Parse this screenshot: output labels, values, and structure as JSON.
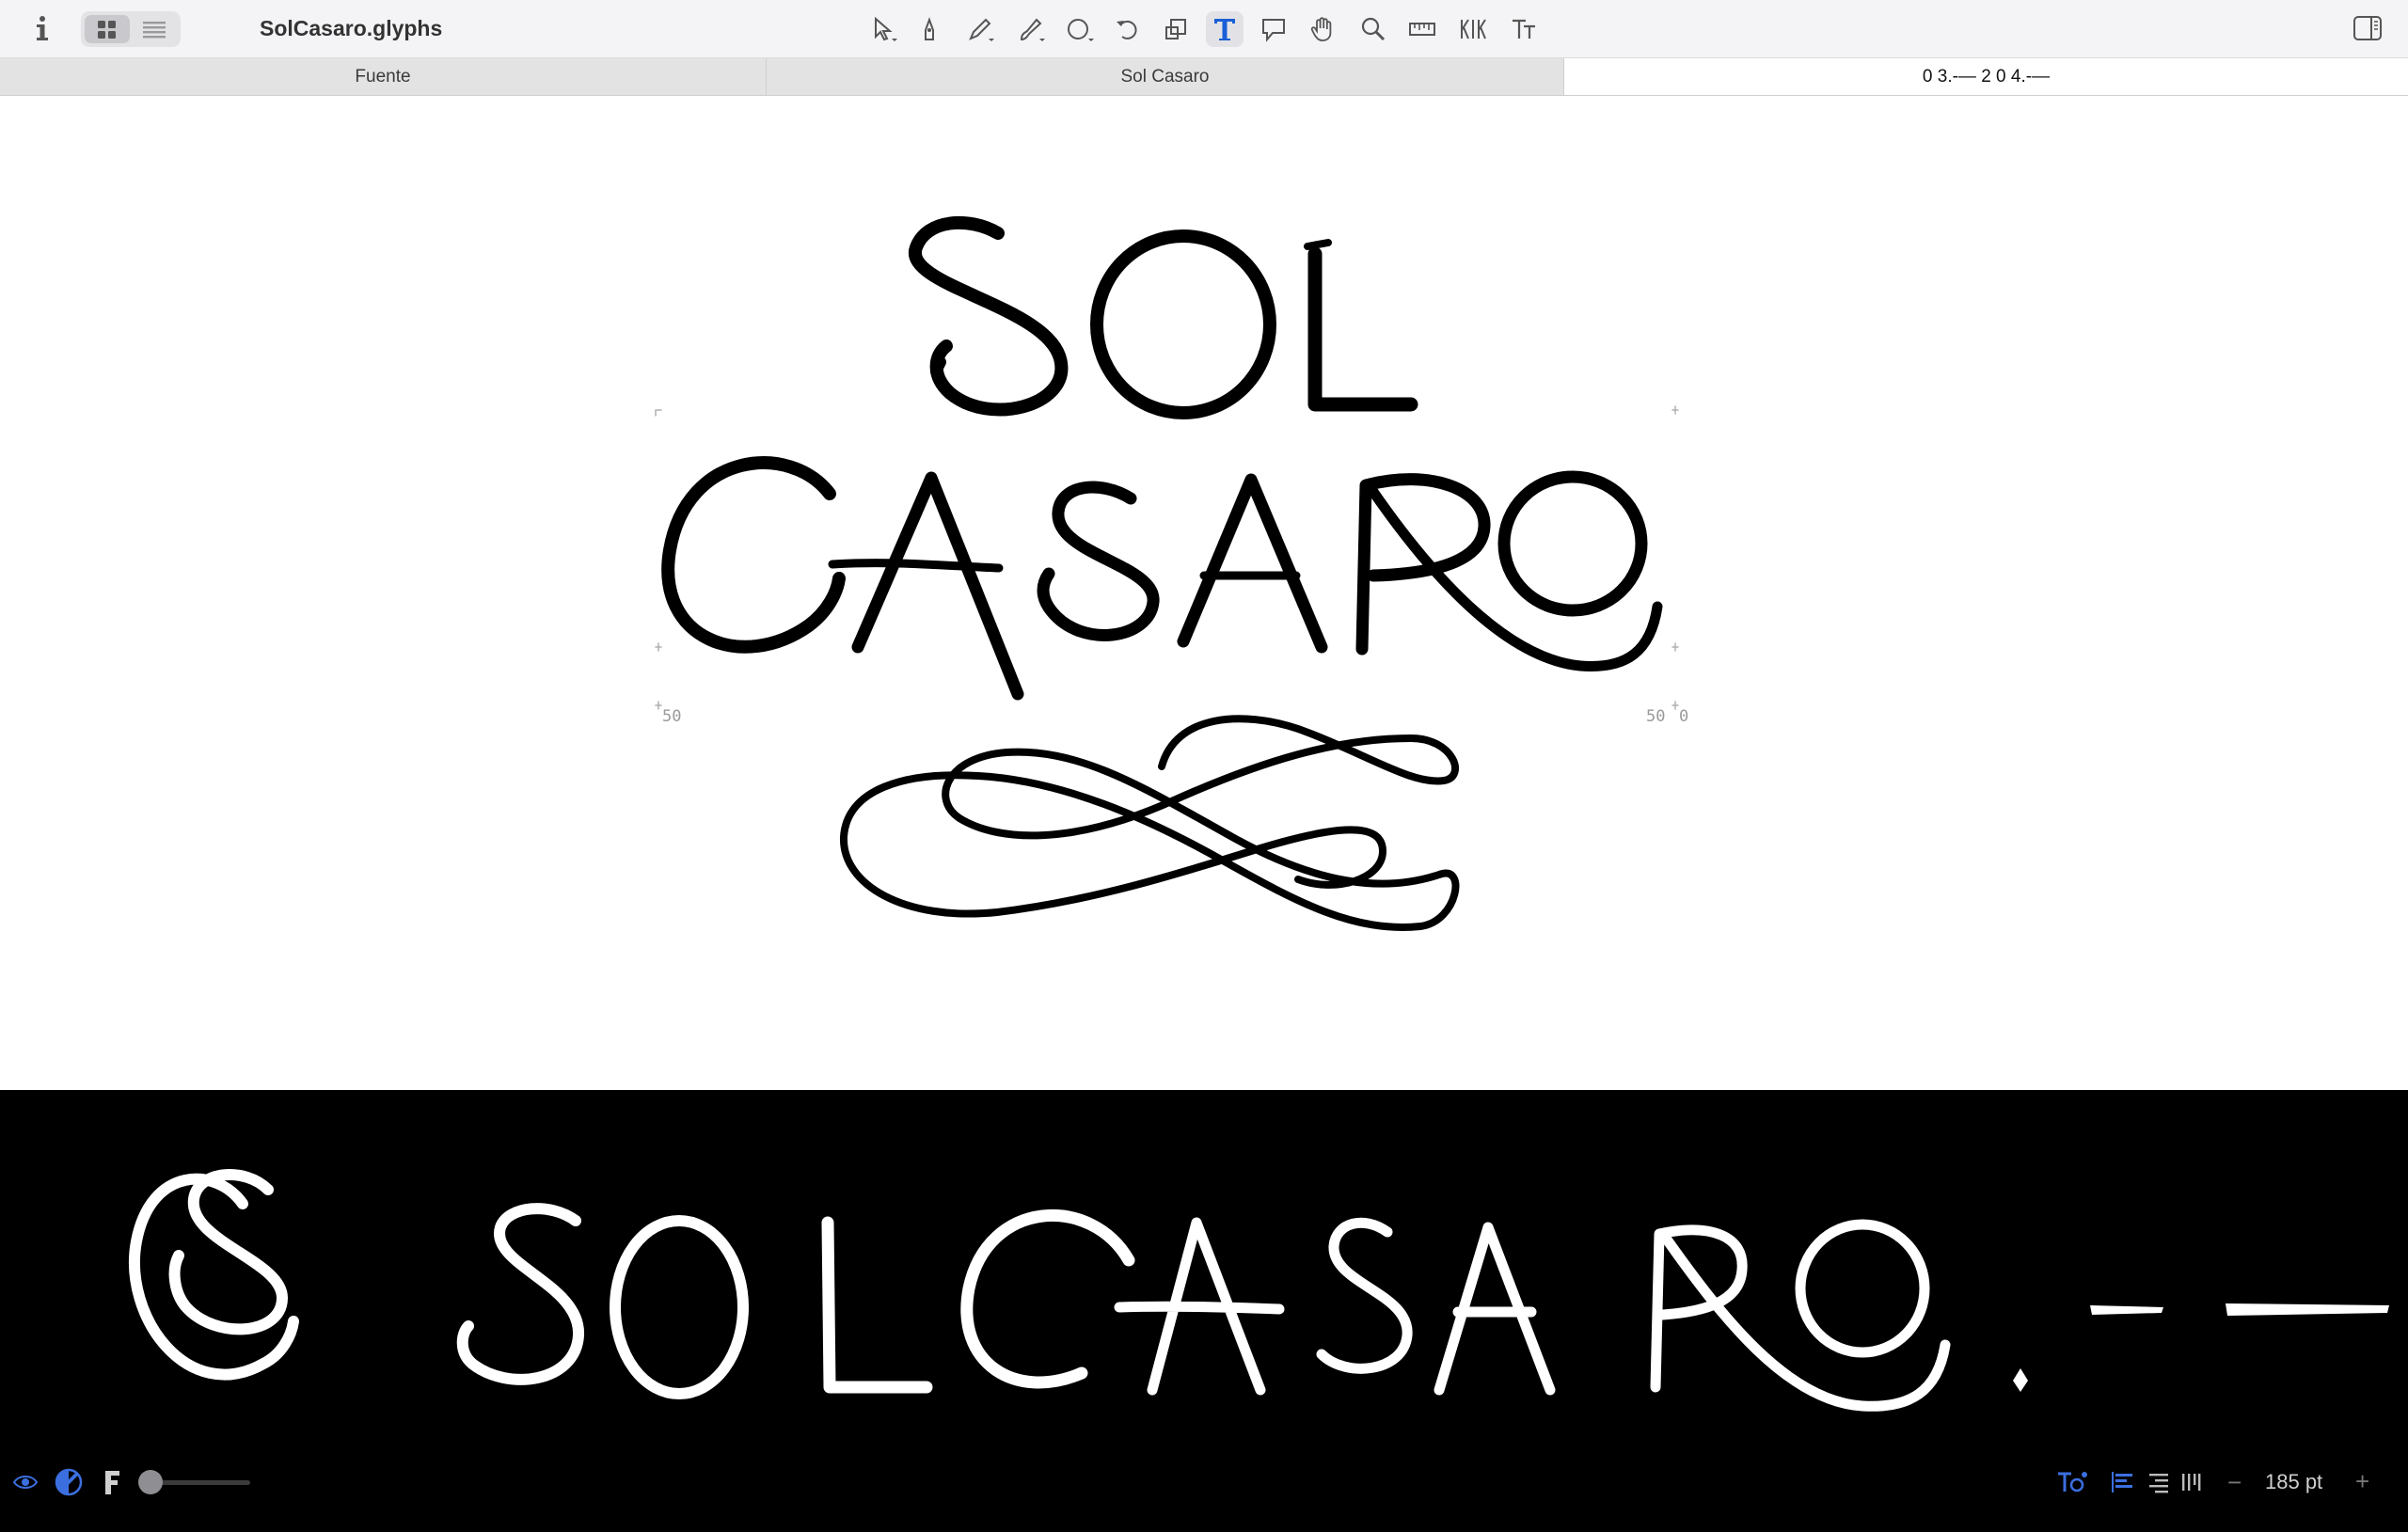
{
  "window": {
    "title": "SolCasaro.glyphs",
    "accent_color": "#1a5fd6"
  },
  "toolbar": {
    "info_icon": "info-icon",
    "view_modes": [
      "grid-view-icon",
      "list-view-icon"
    ],
    "active_view": "grid-view-icon",
    "tools": [
      "select-tool-icon",
      "draw-tool-icon",
      "pencil-tool-icon",
      "brush-tool-icon",
      "primitives-tool-icon",
      "rotate-tool-icon",
      "scale-tool-icon",
      "text-tool-icon",
      "annotation-tool-icon",
      "hand-tool-icon",
      "zoom-tool-icon",
      "measurement-tool-icon",
      "kerning-tool-icon",
      "text-metrics-tool-icon"
    ],
    "active_tool": "text-tool-icon",
    "right_icon": "sidebar-toggle-icon"
  },
  "tabs": [
    {
      "label": "Fuente"
    },
    {
      "label": "Sol Casaro"
    },
    {
      "label": "0 3.-— 2  0 4.-—"
    }
  ],
  "canvas": {
    "line_1": "SOL",
    "line_2": "CASARO",
    "ornament": "flourish",
    "metrics": {
      "left_sidebearing": "50",
      "right_sidebearing": "50",
      "right_extra": "0"
    }
  },
  "preview": {
    "text": "ꟷ SOLCASARO.-—",
    "glyphs": [
      "S-over-C-monogram",
      "S",
      "O",
      "L",
      "C",
      "A",
      "S",
      "A",
      "R",
      "O",
      "period",
      "hyphen",
      "emdash"
    ],
    "background": "#000000",
    "foreground": "#ffffff"
  },
  "bottom_bar": {
    "icons_left": [
      "eye-icon",
      "contrast-icon",
      "font-icon"
    ],
    "slider_value": 0,
    "icons_right": [
      "text-options-icon",
      "align-left-icon",
      "align-right-icon",
      "vertical-text-icon"
    ],
    "font_size": "185 pt",
    "zoom_out": "−",
    "zoom_in": "+"
  }
}
